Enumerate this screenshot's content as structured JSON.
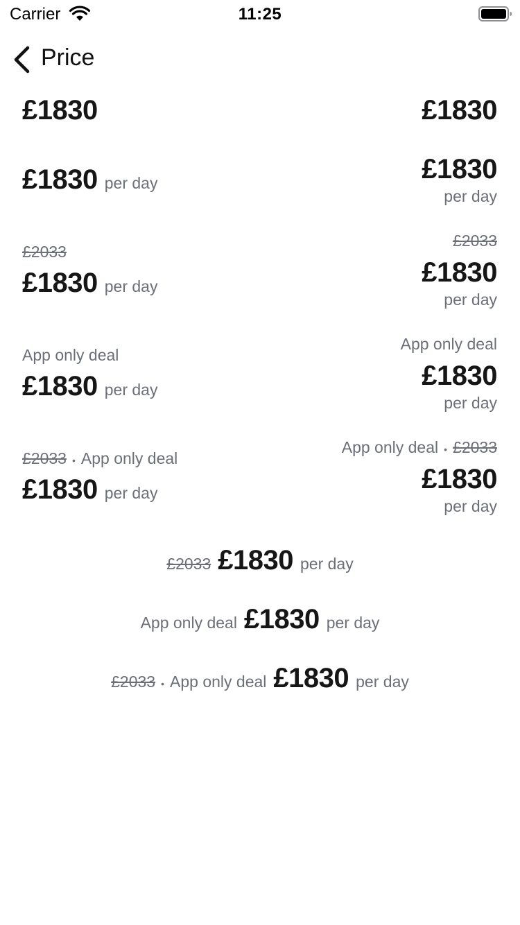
{
  "status_bar": {
    "carrier": "Carrier",
    "time": "11:25"
  },
  "nav": {
    "title": "Price"
  },
  "texts": {
    "price": "£1830",
    "per_day": "per day",
    "old_price": "£2033",
    "deal": "App only deal",
    "separator": "•"
  }
}
